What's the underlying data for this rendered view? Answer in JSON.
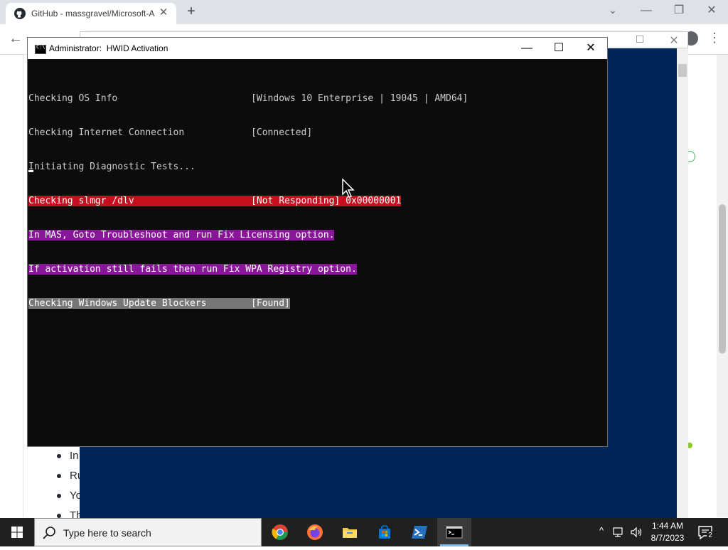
{
  "browser": {
    "tab_title": "GitHub - massgravel/Microsoft-A",
    "tab_close": "✕",
    "new_tab": "+",
    "tab_search": "⌄",
    "min": "—",
    "restore": "❐",
    "close": "✕",
    "back": "←",
    "forward": "→",
    "menu": "⋮"
  },
  "webpage": {
    "bullets": [
      "In",
      "Ru",
      "Yo",
      "Th"
    ]
  },
  "bluewin": {
    "max": "☐",
    "close": "✕"
  },
  "console": {
    "title_admin": "Administrator:",
    "title_name": "HWID Activation",
    "min": "—",
    "max": "☐",
    "close": "✕",
    "lines": {
      "l1": "Checking OS Info                        [Windows 10 Enterprise | 19045 | AMD64]",
      "l2": "Checking Internet Connection            [Connected]",
      "l3": "Initiating Diagnostic Tests...",
      "l4": "Checking slmgr /dlv                     [Not Responding] 0x00000001",
      "l5": "In MAS, Goto Troubleshoot and run Fix Licensing option.",
      "l6": "If activation still fails then run Fix WPA Registry option.",
      "l7": "Checking Windows Update Blockers        [Found]"
    },
    "colors": {
      "red": "#c50f1f",
      "purple": "#881798",
      "gray": "#767676"
    }
  },
  "taskbar": {
    "search_placeholder": "Type here to search",
    "time": "1:44 AM",
    "date": "8/7/2023",
    "notification_count": "2",
    "tray_chevron": "^",
    "apps": [
      "chrome-icon",
      "firefox-icon",
      "file-explorer-icon",
      "microsoft-store-icon",
      "powershell-icon",
      "command-prompt-icon"
    ]
  }
}
